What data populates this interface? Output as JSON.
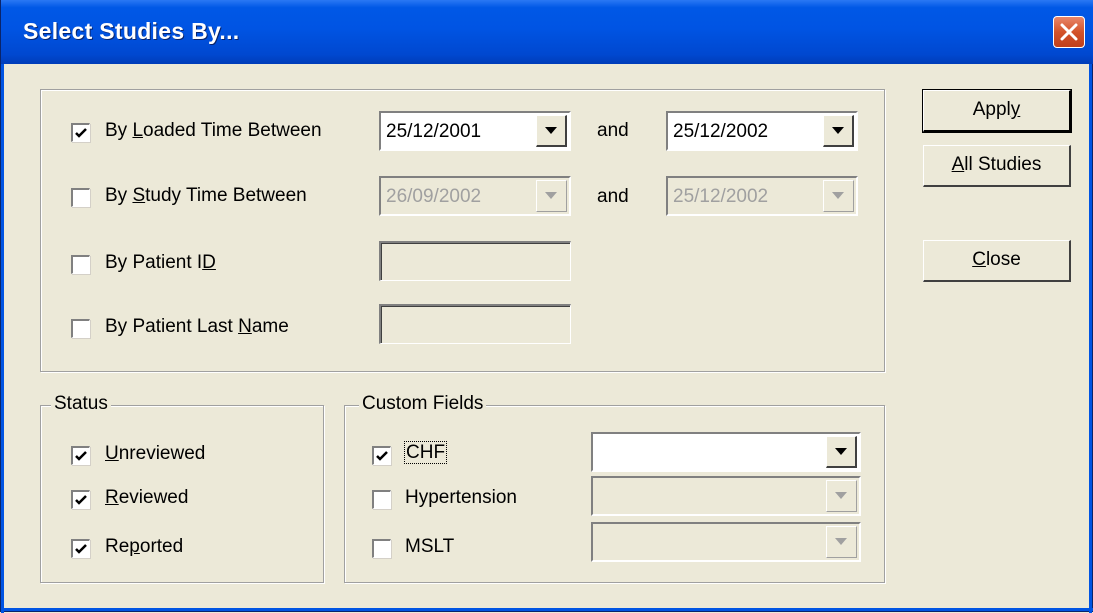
{
  "window": {
    "title": "Select Studies By..."
  },
  "criteria": {
    "loaded_time": {
      "label_pre": "By ",
      "label_u": "L",
      "label_post": "oaded Time Between",
      "checked": true,
      "from": "25/12/2001",
      "and": "and",
      "to": "25/12/2002"
    },
    "study_time": {
      "label_pre": "By ",
      "label_u": "S",
      "label_post": "tudy Time Between",
      "checked": false,
      "from": "26/09/2002",
      "and": "and",
      "to": "25/12/2002"
    },
    "patient_id": {
      "label_pre": "By Patient I",
      "label_u": "D",
      "label_post": "",
      "checked": false,
      "value": ""
    },
    "patient_last_name": {
      "label_pre": "By Patient Last ",
      "label_u": "N",
      "label_post": "ame",
      "checked": false,
      "value": ""
    }
  },
  "status": {
    "legend": "Status",
    "items": [
      {
        "u": "U",
        "rest": "nreviewed",
        "checked": true
      },
      {
        "u": "R",
        "rest": "eviewed",
        "checked": true
      },
      {
        "pre": "Re",
        "u": "p",
        "rest": "orted",
        "checked": true
      }
    ]
  },
  "custom_fields": {
    "legend": "Custom Fields",
    "items": [
      {
        "label": "CHF",
        "checked": true,
        "value": "",
        "enabled": true
      },
      {
        "label": "Hypertension",
        "checked": false,
        "value": "",
        "enabled": false
      },
      {
        "label": "MSLT",
        "checked": false,
        "value": "",
        "enabled": false
      }
    ]
  },
  "buttons": {
    "apply_pre": "Appl",
    "apply_u": "y",
    "all_u": "A",
    "all_rest": "ll Studies",
    "close_u": "C",
    "close_rest": "lose"
  }
}
